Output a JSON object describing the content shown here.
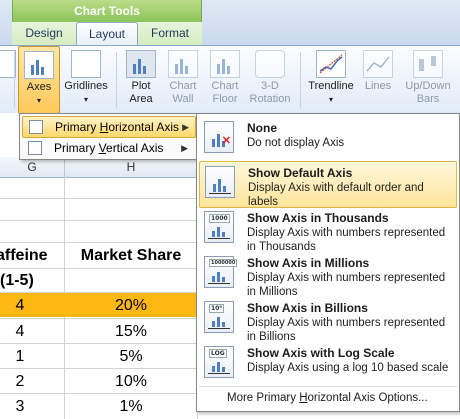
{
  "ribbon": {
    "context_label": "Chart Tools",
    "tabs": [
      {
        "label": "Design"
      },
      {
        "label": "Layout"
      },
      {
        "label": "Format"
      }
    ],
    "buttons": [
      {
        "label": "Axes"
      },
      {
        "label": "Gridlines"
      },
      {
        "label_line1": "Plot",
        "label_line2": "Area"
      },
      {
        "label_line1": "Chart",
        "label_line2": "Wall"
      },
      {
        "label_line1": "Chart",
        "label_line2": "Floor"
      },
      {
        "label_line1": "3-D",
        "label_line2": "Rotation"
      },
      {
        "label": "Trendline"
      },
      {
        "label": "Lines"
      },
      {
        "label_line1": "Up/Down",
        "label_line2": "Bars"
      }
    ]
  },
  "axes_menu": {
    "items": [
      {
        "prefix": "Primary ",
        "key": "H",
        "suffix": "orizontal Axis"
      },
      {
        "prefix": "Primary ",
        "key": "V",
        "suffix": "ertical Axis"
      }
    ]
  },
  "axis_options": {
    "items": [
      {
        "title": "None",
        "desc": "Do not display Axis",
        "icon": "axis-none-icon"
      },
      {
        "title": "Show Default Axis",
        "desc": "Display Axis with default order and labels",
        "icon": "axis-default-icon"
      },
      {
        "title": "Show Axis in Thousands",
        "desc": "Display Axis with numbers represented in Thousands",
        "icon": "axis-thousands-icon",
        "tag": "1000"
      },
      {
        "title": "Show Axis in Millions",
        "desc": "Display Axis with numbers represented in Millions",
        "icon": "axis-millions-icon",
        "tag": "1000000"
      },
      {
        "title": "Show Axis in Billions",
        "desc": "Display Axis with numbers represented in Billions",
        "icon": "axis-billions-icon",
        "tag": "10⁹"
      },
      {
        "title": "Show Axis with Log Scale",
        "desc": "Display Axis using a log 10 based scale",
        "icon": "axis-log-icon",
        "tag": "LOG"
      }
    ],
    "more": {
      "prefix": "More Primary ",
      "key": "H",
      "suffix": "orizontal Axis Options..."
    }
  },
  "sheet": {
    "columns": [
      "G",
      "H"
    ],
    "header_row": {
      "g": "affeine",
      "h": "Market Share"
    },
    "sub_row": {
      "g": "(1-5)"
    },
    "rows": [
      {
        "g": "4",
        "h": "20%"
      },
      {
        "g": "4",
        "h": "15%"
      },
      {
        "g": "1",
        "h": "5%"
      },
      {
        "g": "2",
        "h": "10%"
      },
      {
        "g": "3",
        "h": "1%"
      }
    ]
  },
  "colors": {
    "context_green": "#8cc45a",
    "highlight_row": "#fdb813",
    "menu_hover": "#ffd96a"
  }
}
